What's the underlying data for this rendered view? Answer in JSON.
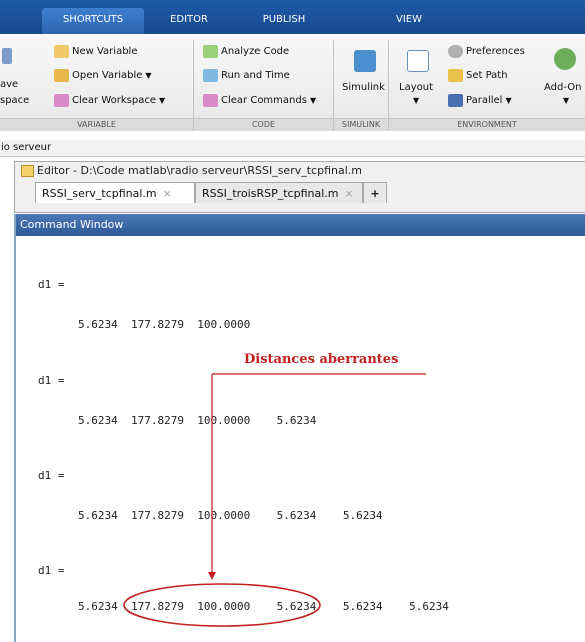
{
  "tabs": [
    "SHORTCUTS",
    "EDITOR",
    "PUBLISH",
    "VIEW"
  ],
  "ribbon": {
    "left_partial": [
      "ave",
      "space"
    ],
    "variable": {
      "new_variable": "New Variable",
      "open_variable": "Open Variable",
      "clear_workspace": "Clear Workspace",
      "section_label": "VARIABLE"
    },
    "code": {
      "analyze_code": "Analyze Code",
      "run_and_time": "Run and Time",
      "clear_commands": "Clear Commands",
      "section_label": "CODE"
    },
    "simulink": {
      "label": "Simulink",
      "section_label": "SIMULINK"
    },
    "environment": {
      "layout": "Layout",
      "preferences": "Preferences",
      "set_path": "Set Path",
      "parallel": "Parallel",
      "add_ons": "Add-On",
      "section_label": "ENVIRONMENT"
    }
  },
  "path_bar": "io serveur",
  "editor": {
    "title": "Editor - D:\\Code matlab\\radio serveur\\RSSI_serv_tcpfinal.m",
    "tabs": [
      "RSSI_serv_tcpfinal.m",
      "RSSI_troisRSP_tcpfinal.m"
    ],
    "add_tab": "+"
  },
  "command_window": {
    "title": "Command Window",
    "var_label": "d1 =",
    "rows": [
      "5.6234  177.8279  100.0000",
      "5.6234  177.8279  100.0000    5.6234",
      "5.6234  177.8279  100.0000    5.6234    5.6234",
      "5.6234  177.8279  100.0000    5.6234    5.6234    5.6234"
    ]
  },
  "annotation": {
    "text": "Distances aberrantes",
    "color": "#c0201e"
  }
}
